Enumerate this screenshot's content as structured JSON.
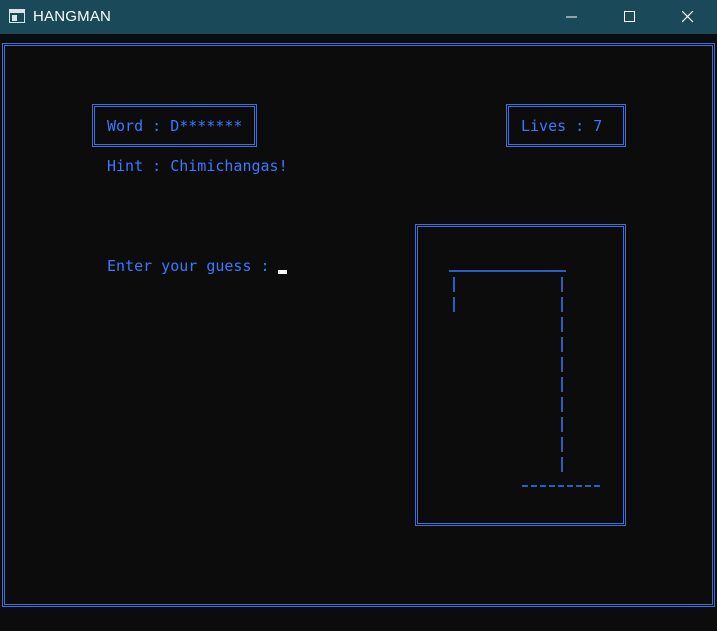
{
  "window": {
    "title": "HANGMAN",
    "icon": "console-window-icon",
    "controls": [
      "minimize-icon",
      "maximize-icon",
      "close-icon"
    ]
  },
  "game": {
    "word_line": "Word : D*******",
    "lives_line": "Lives : 7",
    "hint_line": "Hint : Chimichangas!",
    "prompt_line": "Enter your guess : ",
    "guess_value": ""
  },
  "colors": {
    "titlebar": "#1a4a5a",
    "background": "#0c0c0c",
    "text": "#3a78ff",
    "border": "#3a6fe0",
    "cursor": "#ffffff"
  }
}
